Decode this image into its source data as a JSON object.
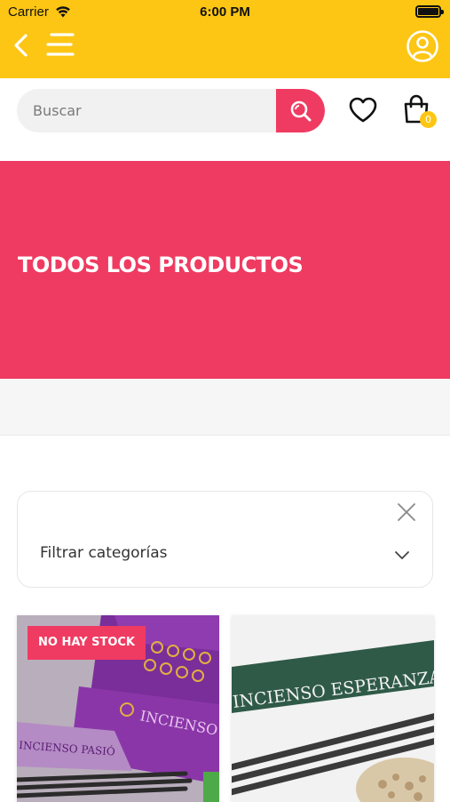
{
  "status_bar": {
    "carrier": "Carrier",
    "time": "6:00 PM"
  },
  "topbar": {
    "back_icon": "chevron-left-icon",
    "menu_icon": "menu-icon",
    "user_icon": "user-circle-icon"
  },
  "search": {
    "placeholder": "Buscar",
    "button_icon": "search-icon"
  },
  "actions": {
    "favorites_icon": "heart-icon",
    "cart_icon": "shopping-bag-icon",
    "cart_count": "0"
  },
  "banner": {
    "title": "TODOS LOS PRODUCTOS"
  },
  "filter": {
    "label": "Filtrar categorías",
    "close_icon": "close-icon",
    "dropdown_icon": "chevron-down-icon"
  },
  "products": [
    {
      "badge": "NO HAY STOCK",
      "box_text_1": "INCIENSO P",
      "box_text_2": "INCIENSO PASIÓ"
    },
    {
      "box_text": "INCIENSO ESPERANZA"
    }
  ],
  "colors": {
    "brand_yellow": "#FDC614",
    "brand_pink": "#EF3B61",
    "search_bg": "#F1F1F1"
  }
}
